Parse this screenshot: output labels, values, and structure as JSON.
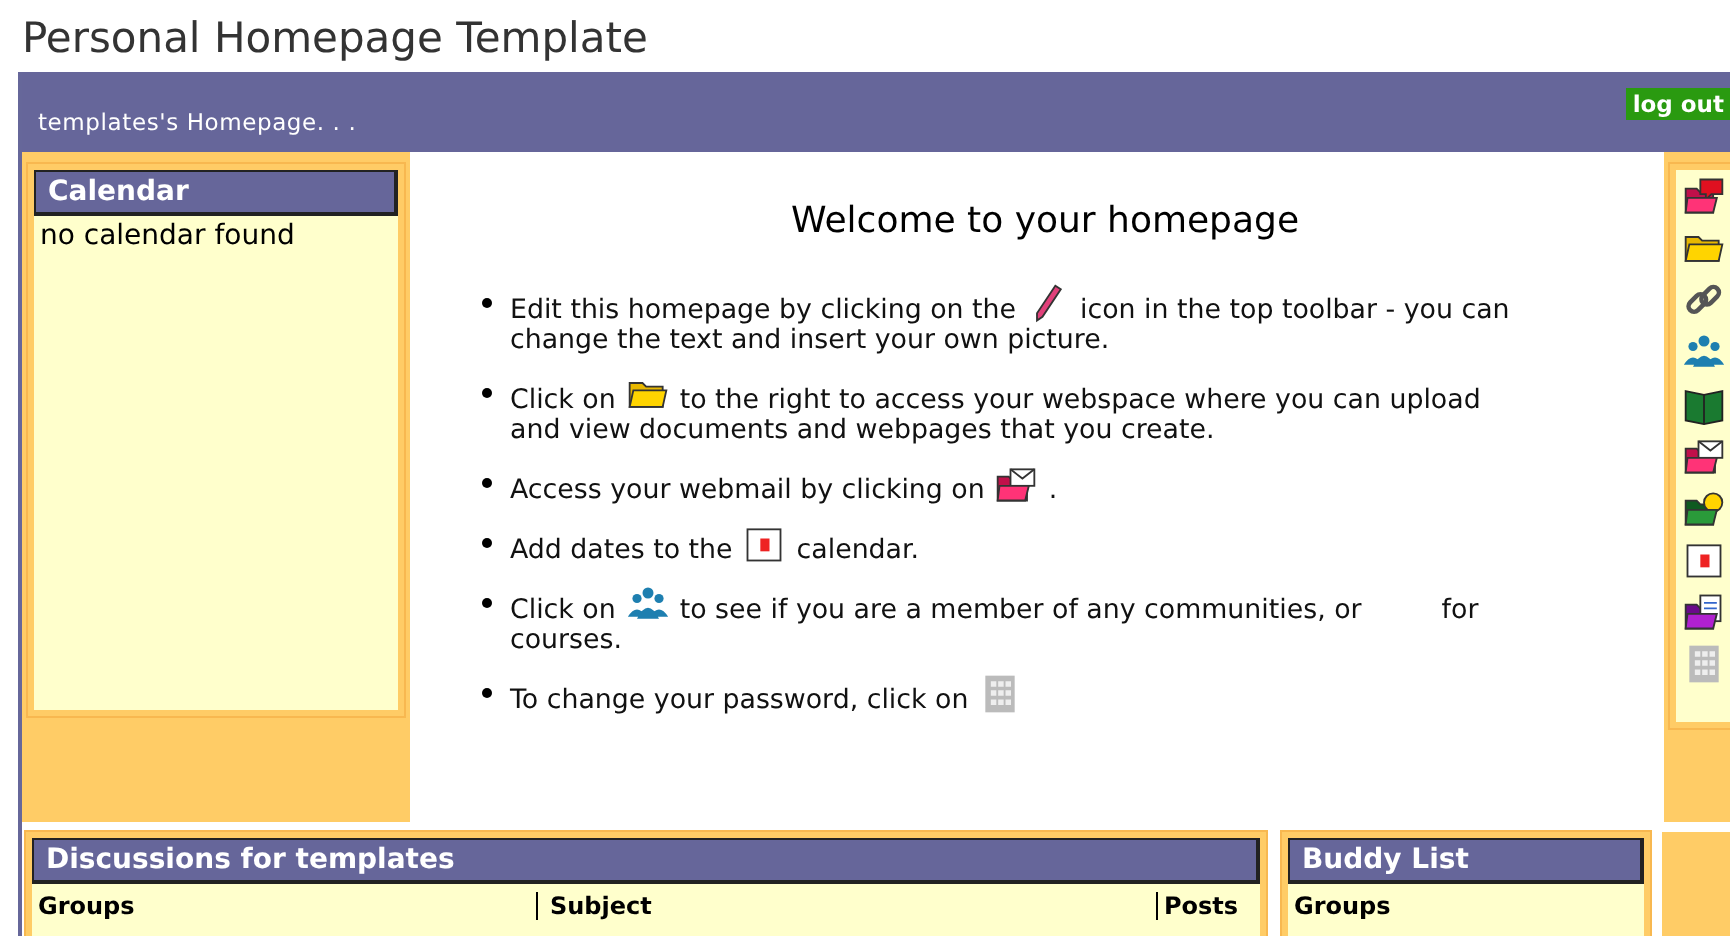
{
  "page_title": "Personal Homepage Template",
  "header": {
    "title": "templates's Homepage. . .",
    "logout": "log out"
  },
  "calendar": {
    "title": "Calendar",
    "message": "no calendar found"
  },
  "welcome": {
    "heading": "Welcome to your homepage",
    "bullets": [
      {
        "lines": [
          [
            {
              "kind": "text",
              "text": "Edit this homepage by clicking on the"
            },
            {
              "kind": "icon"
            },
            {
              "kind": "text",
              "text": "icon in the top toolbar - you can"
            }
          ],
          [
            {
              "kind": "text",
              "text": "change the text and insert your own picture."
            }
          ]
        ]
      },
      {
        "lines": [
          [
            {
              "kind": "text",
              "text": "Click on"
            },
            {
              "kind": "icon"
            },
            {
              "kind": "text",
              "text": "to the right to access your webspace where you can upload"
            }
          ],
          [
            {
              "kind": "text",
              "text": "and view documents and webpages that you create."
            }
          ]
        ]
      },
      {
        "lines": [
          [
            {
              "kind": "text",
              "text": "Access your webmail by clicking on"
            },
            {
              "kind": "icon"
            },
            {
              "kind": "text",
              "text": "."
            }
          ]
        ]
      },
      {
        "lines": [
          [
            {
              "kind": "text",
              "text": "Add dates to the"
            },
            {
              "kind": "icon"
            },
            {
              "kind": "text",
              "text": "calendar."
            }
          ]
        ]
      },
      {
        "lines": [
          [
            {
              "kind": "text",
              "text": "Click on"
            },
            {
              "kind": "icon"
            },
            {
              "kind": "text",
              "text": "to see if you are a member of any communities, or"
            },
            {
              "kind": "gap"
            },
            {
              "kind": "text",
              "text": "for"
            }
          ],
          [
            {
              "kind": "text",
              "text": "courses."
            }
          ]
        ]
      },
      {
        "lines": [
          [
            {
              "kind": "text",
              "text": "To change your password, click on"
            },
            {
              "kind": "icon"
            }
          ]
        ]
      }
    ]
  },
  "discussions": {
    "title": "Discussions for templates",
    "columns": [
      "Groups",
      "Subject",
      "Posts"
    ]
  },
  "buddy_list": {
    "title": "Buddy List",
    "columns": [
      "Groups"
    ]
  }
}
